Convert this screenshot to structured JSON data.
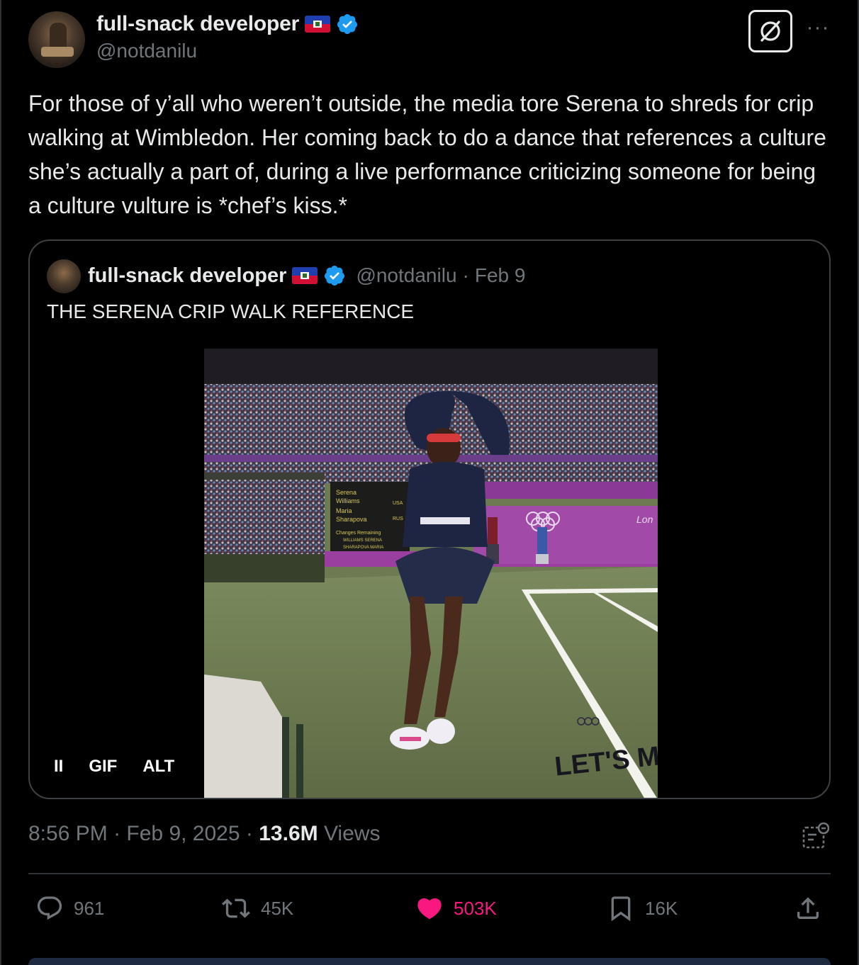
{
  "author": {
    "display_name": "full-snack developer",
    "handle": "@notdanilu",
    "verified": true,
    "flag": "haiti-flag"
  },
  "header": {
    "grok_icon": "grok-icon",
    "more_icon": "more-icon",
    "more_label": "···"
  },
  "tweet": {
    "text": "For those of y’all who weren’t outside, the media tore Serena to shreds for crip walking at Wimbledon. Her coming back to do a dance that references a culture she’s actually a part of, during a live performance criticizing someone for being a culture vulture is *chef’s kiss.*"
  },
  "quote": {
    "display_name": "full-snack developer",
    "handle": "@notdanilu",
    "separator": "·",
    "date": "Feb 9",
    "text": "THE SERENA CRIP WALK REFERENCE",
    "media": {
      "scoreboard_lines": [
        "Serena",
        "Williams",
        "Maria",
        "Sharapova",
        "USA",
        "RUS",
        "Changes Remaining",
        "WILLIAMS SERENA",
        "SHARAPOVA MARIA"
      ],
      "board_text": "Lon",
      "watermark": "LET'S MOVE"
    },
    "controls": {
      "pause_label": "II",
      "gif_label": "GIF",
      "alt_label": "ALT"
    }
  },
  "meta": {
    "time": "8:56 PM",
    "sep1": "·",
    "date": "Feb 9, 2025",
    "sep2": "·",
    "views_count": "13.6M",
    "views_label": "Views"
  },
  "actions": {
    "replies": "961",
    "reposts": "45K",
    "likes": "503K",
    "bookmarks": "16K"
  },
  "colors": {
    "background": "#000000",
    "text": "#e7e9ea",
    "muted": "#71767b",
    "like": "#f91880",
    "verified": "#1d9bf0",
    "border": "#2f3336"
  }
}
